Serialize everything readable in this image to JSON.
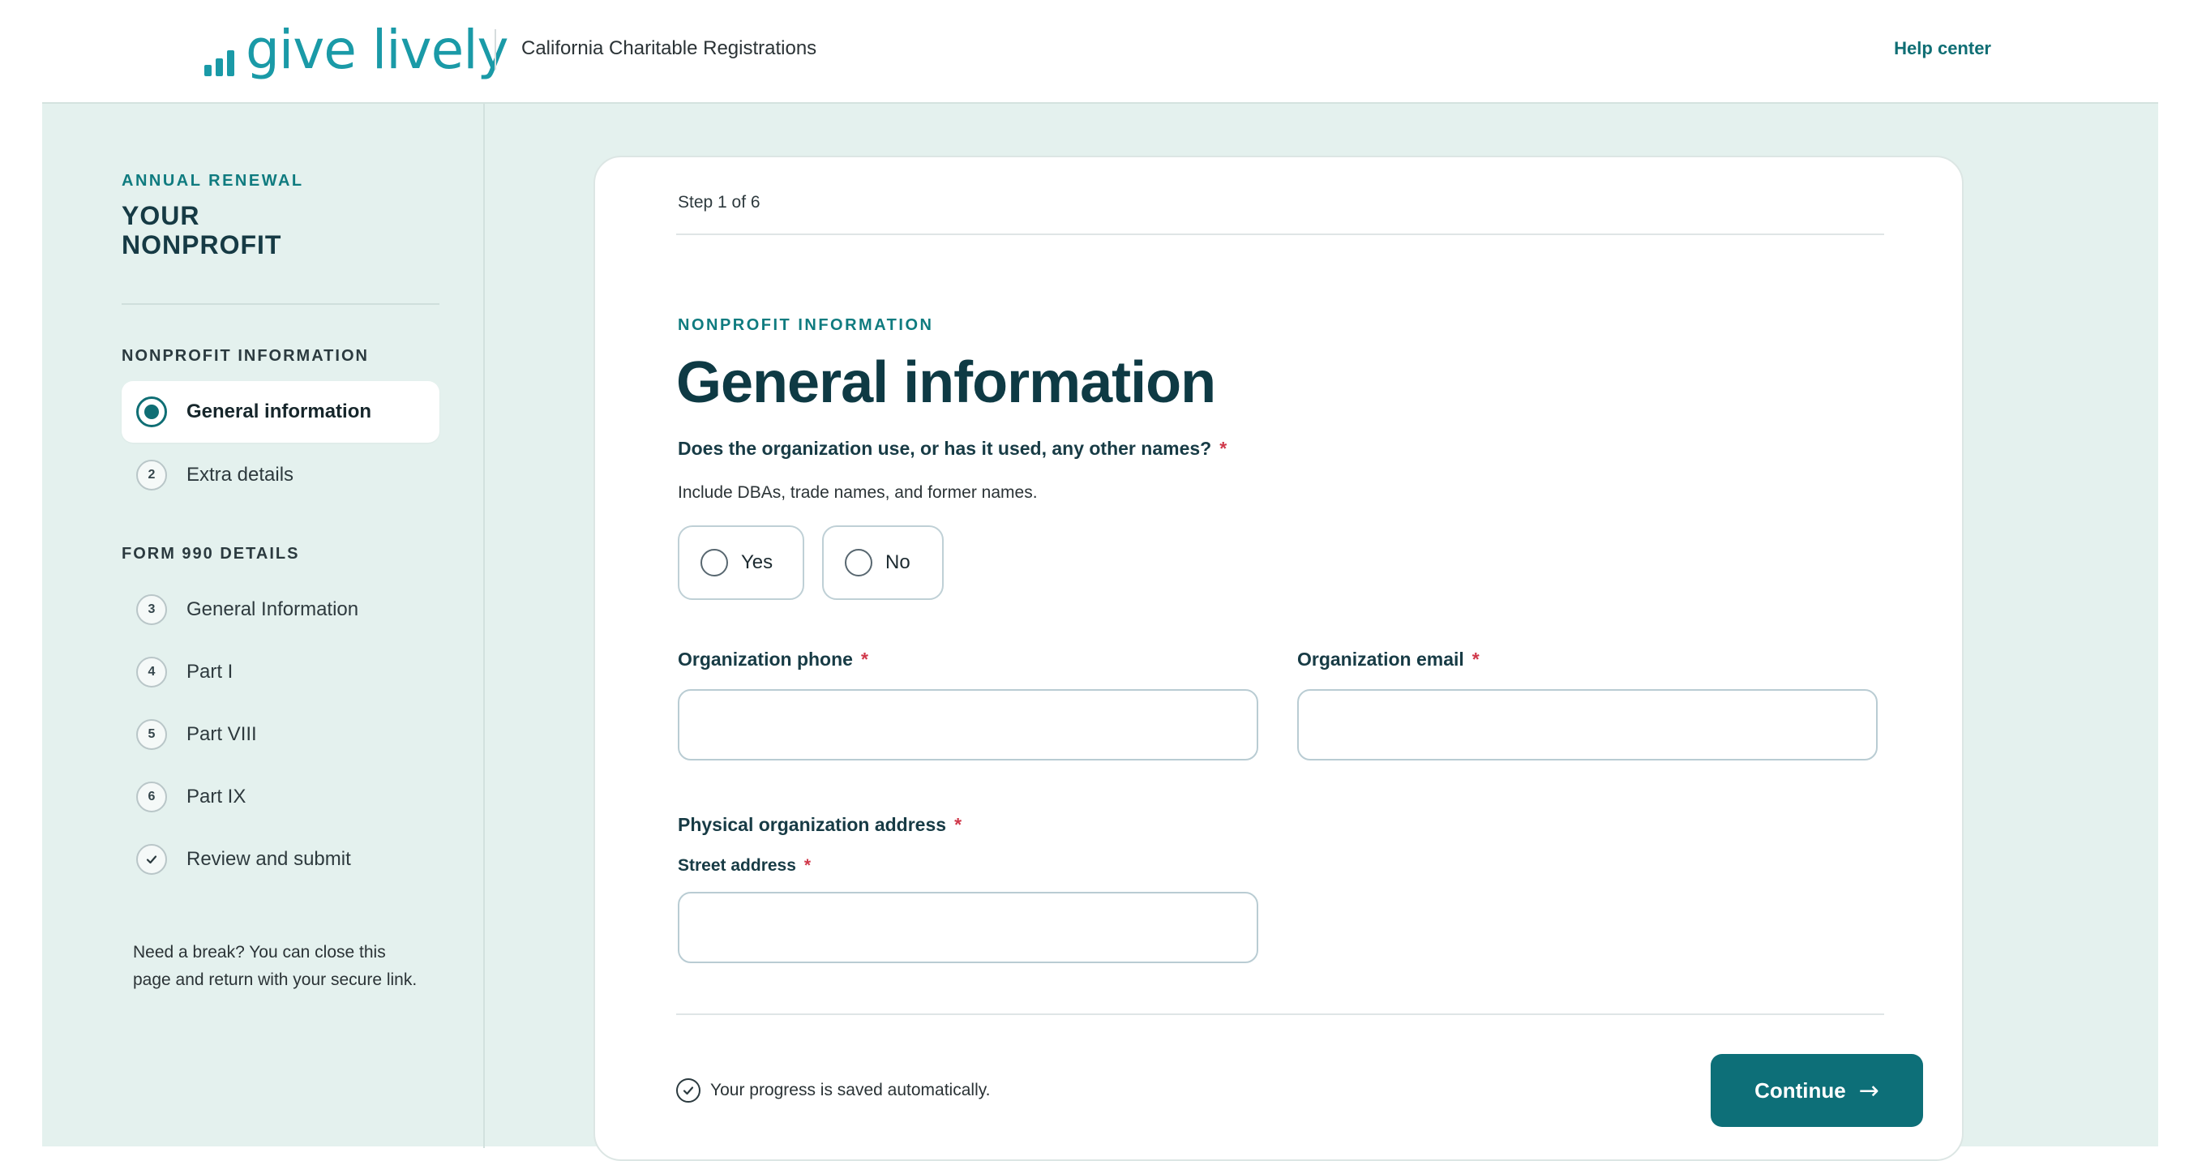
{
  "header": {
    "logo_text": "give lively",
    "app_title": "California Charitable Registrations",
    "help_label": "Help center",
    "brand_color": "#1a9aa7"
  },
  "sidebar": {
    "eyebrow": "ANNUAL RENEWAL",
    "org_name": "YOUR NONPROFIT",
    "sections": [
      {
        "title": "NONPROFIT INFORMATION",
        "items": [
          {
            "marker": "active",
            "label": "General information"
          },
          {
            "marker": "2",
            "label": "Extra details"
          }
        ]
      },
      {
        "title": "FORM 990 DETAILS",
        "items": [
          {
            "marker": "3",
            "label": "General Information"
          },
          {
            "marker": "4",
            "label": "Part I"
          },
          {
            "marker": "5",
            "label": "Part VIII"
          },
          {
            "marker": "6",
            "label": "Part IX"
          },
          {
            "marker": "check-icon",
            "label": "Review and submit"
          }
        ]
      }
    ],
    "break_note": "Need a break? You can close this page and return with your secure link."
  },
  "form": {
    "step_label": "Step 1 of 6",
    "eyebrow": "NONPROFIT INFORMATION",
    "title": "General information",
    "required_mark": "*",
    "other_names": {
      "label": "Does the organization use, or has it used, any other names?",
      "help": "Include DBAs, trade names, and former names.",
      "options": [
        "Yes",
        "No"
      ],
      "selected": ""
    },
    "phone": {
      "label": "Organization phone",
      "value": ""
    },
    "email": {
      "label": "Organization email",
      "value": ""
    },
    "address": {
      "label": "Physical organization address",
      "street_label": "Street address",
      "street_value": ""
    },
    "saved_note": "Your progress is saved automatically.",
    "continue_label": "Continue",
    "continue_arrow": "→",
    "accent_color": "#0d6f78"
  }
}
